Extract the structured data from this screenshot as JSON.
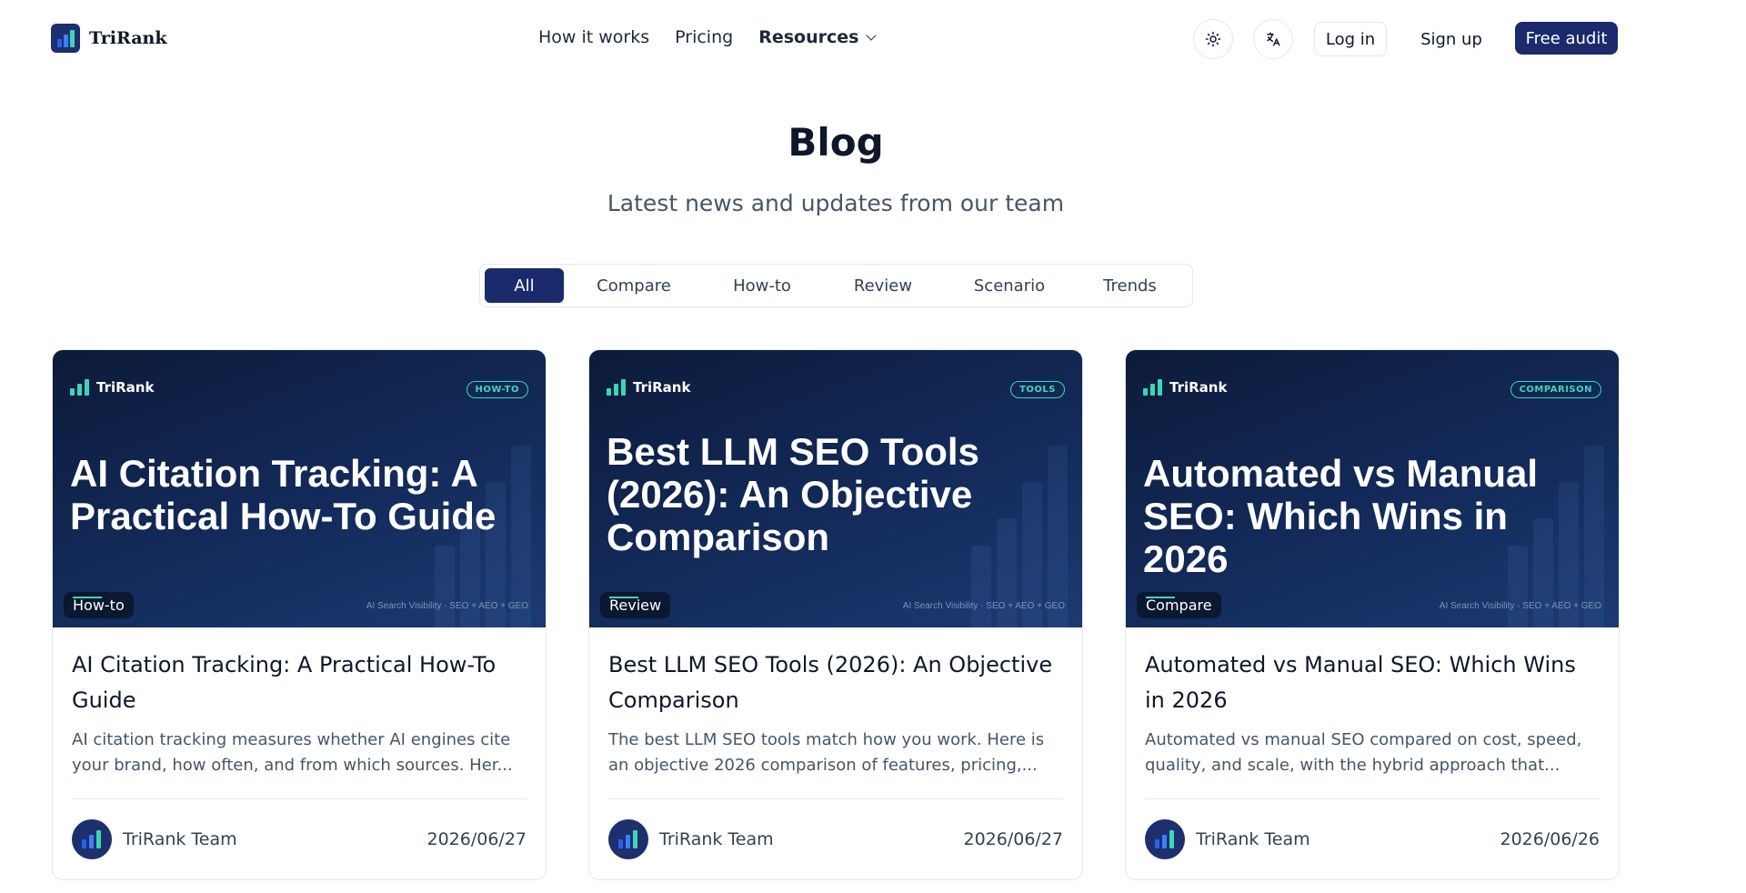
{
  "brand": {
    "name": "TriRank"
  },
  "nav": {
    "how": "How it works",
    "pricing": "Pricing",
    "resources": "Resources"
  },
  "header": {
    "login": "Log in",
    "signup": "Sign up",
    "audit": "Free audit"
  },
  "hero": {
    "title": "Blog",
    "subtitle": "Latest news and updates from our team"
  },
  "tabs": [
    "All",
    "Compare",
    "How-to",
    "Review",
    "Scenario",
    "Trends"
  ],
  "active_tab": "All",
  "colors": {
    "primary": "#1a2a6c",
    "accent": "#3dd6b5",
    "hero_bg": "#0d1b3a"
  },
  "posts": [
    {
      "brand": "TriRank",
      "tag": "HOW-TO",
      "hero_title": "AI Citation Tracking: A Practical How-To Guide",
      "hero_footer": "AI Search Visibility · SEO + AEO + GEO",
      "category": "How-to",
      "title": "AI Citation Tracking: A Practical How-To Guide",
      "excerpt": "AI citation tracking measures whether AI engines cite your brand, how often, and from which sources. Her...",
      "author": "TriRank Team",
      "date": "2026/06/27"
    },
    {
      "brand": "TriRank",
      "tag": "TOOLS",
      "hero_title": "Best LLM SEO Tools (2026): An Objective Comparison",
      "hero_footer": "AI Search Visibility · SEO + AEO + GEO",
      "category": "Review",
      "title": "Best LLM SEO Tools (2026): An Objective Comparison",
      "excerpt": "The best LLM SEO tools match how you work. Here is an objective 2026 comparison of features, pricing,...",
      "author": "TriRank Team",
      "date": "2026/06/27"
    },
    {
      "brand": "TriRank",
      "tag": "COMPARISON",
      "hero_title": "Automated vs Manual SEO: Which Wins in 2026",
      "hero_footer": "AI Search Visibility · SEO + AEO + GEO",
      "category": "Compare",
      "title": "Automated vs Manual SEO: Which Wins in 2026",
      "excerpt": "Automated vs manual SEO compared on cost, speed, quality, and scale, with the hybrid approach that...",
      "author": "TriRank Team",
      "date": "2026/06/26"
    }
  ]
}
